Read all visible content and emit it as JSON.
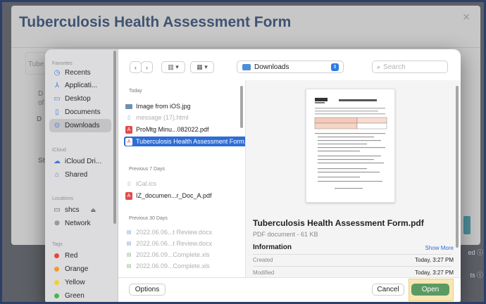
{
  "background": {
    "title": "Tuberculosis Health Assessment Form",
    "tab_label": "Tube",
    "frag_d1": "D",
    "frag_of": "of",
    "frag_d2": "D",
    "frag_st": "St",
    "right_info": "ed ⓘ",
    "right_info2": "ts ⓘ"
  },
  "sidebar": {
    "favorites_label": "Favorites",
    "favorites": [
      {
        "label": "Recents",
        "icon": "clock-icon"
      },
      {
        "label": "Applicati...",
        "icon": "apps-icon"
      },
      {
        "label": "Desktop",
        "icon": "desktop-icon"
      },
      {
        "label": "Documents",
        "icon": "document-icon"
      },
      {
        "label": "Downloads",
        "icon": "download-icon"
      }
    ],
    "icloud_label": "iCloud",
    "icloud": [
      {
        "label": "iCloud Dri...",
        "icon": "cloud-icon"
      },
      {
        "label": "Shared",
        "icon": "shared-folder-icon"
      }
    ],
    "locations_label": "Locations",
    "locations": [
      {
        "label": "shcs",
        "icon": "computer-icon"
      },
      {
        "label": "Network",
        "icon": "globe-icon"
      }
    ],
    "tags_label": "Tags",
    "tags": [
      {
        "label": "Red",
        "color": "#e5463d"
      },
      {
        "label": "Orange",
        "color": "#f29a2e"
      },
      {
        "label": "Yellow",
        "color": "#f2cf2e"
      },
      {
        "label": "Green",
        "color": "#4ab54e"
      }
    ]
  },
  "toolbar": {
    "back": "‹",
    "forward": "›",
    "view_columns": "▥ ▾",
    "view_group": "▦ ▾",
    "location": "Downloads",
    "search_placeholder": "Search"
  },
  "files": {
    "today_label": "Today",
    "today": [
      {
        "name": "Image from iOS.jpg",
        "type": "img",
        "dim": false
      },
      {
        "name": "message (17).html",
        "type": "doc",
        "dim": true
      },
      {
        "name": "ProMtg Minu...082022.pdf",
        "type": "pdf",
        "dim": false
      },
      {
        "name": "Tuberculosis Health Assessment Form.pdf",
        "type": "pdf",
        "dim": false
      }
    ],
    "prev7_label": "Previous 7 Days",
    "prev7": [
      {
        "name": "iCal.ics",
        "type": "doc",
        "dim": true
      },
      {
        "name": "IZ_documen...r_Doc_A.pdf",
        "type": "pdf",
        "dim": false
      }
    ],
    "prev30_label": "Previous 30 Days",
    "prev30": [
      {
        "name": "2022.06.06...t Review.docx",
        "type": "doc",
        "dim": true
      },
      {
        "name": "2022.06.06...t Review.docx",
        "type": "doc",
        "dim": true
      },
      {
        "name": "2022.06.09...Complete.xls",
        "type": "xls",
        "dim": true
      },
      {
        "name": "2022.06.09...Complete.xls",
        "type": "xls",
        "dim": true
      }
    ]
  },
  "preview": {
    "file_name": "Tuberculosis Health Assessment Form.pdf",
    "subtitle": "PDF document - 61 KB",
    "info_label": "Information",
    "show_more": "Show More",
    "created_label": "Created",
    "created_value": "Today, 3:27 PM",
    "modified_label": "Modified",
    "modified_value": "Today, 3:27 PM"
  },
  "footer": {
    "options": "Options",
    "cancel": "Cancel",
    "open": "Open"
  }
}
